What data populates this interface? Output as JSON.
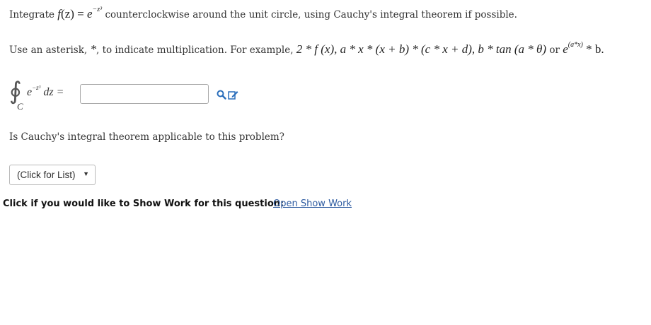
{
  "question": {
    "intro_prefix": "Integrate",
    "intro_suffix": "counterclockwise around the unit circle, using Cauchy's integral theorem if possible.",
    "function_expr": {
      "f": "f",
      "paren": "(z)",
      "equals": "=",
      "base": "e",
      "exponent": "−z³"
    }
  },
  "instructions": {
    "prefix": "Use an asterisk,",
    "asterisk": "*",
    "middle": ", to indicate multiplication. For example,",
    "example_math": "2 * f (x), a * x * (x + b) * (c * x + d), b * tan (a * θ)",
    "or_word": "or",
    "exp_base": "e",
    "exp_power": "(a*x)",
    "exp_tail": "* b."
  },
  "integral": {
    "symbol": "∮",
    "contour": "C",
    "base": "e",
    "exponent": "−z³",
    "dz": "dz =",
    "answer_value": ""
  },
  "icons": {
    "preview": "preview-magnifier-icon",
    "edit": "edit-pencil-icon",
    "color": "#2a6ebb"
  },
  "question2": {
    "text": "Is Cauchy's integral theorem applicable to this problem?"
  },
  "dropdown": {
    "selected": "(Click for List)"
  },
  "show_work": {
    "label": "Click if you would like to Show Work for this question:",
    "link": "Open Show Work"
  }
}
